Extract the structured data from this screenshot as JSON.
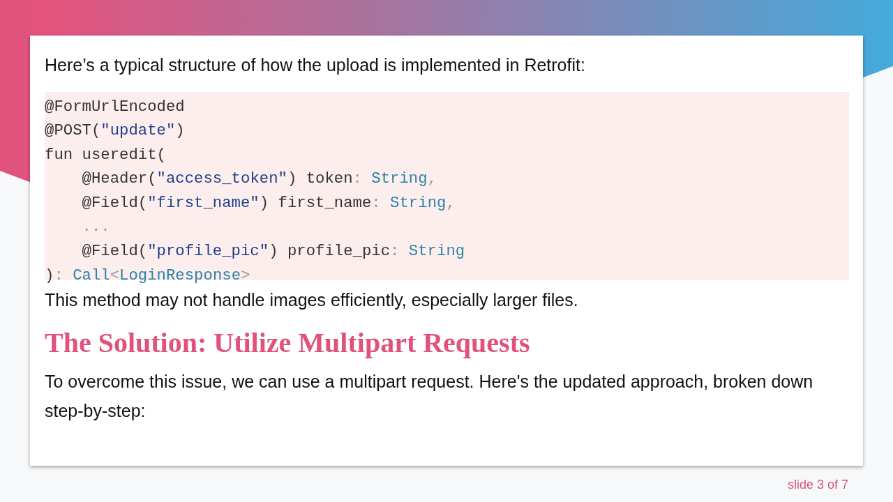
{
  "intro": "Here’s a typical structure of how the upload is implemented in Retrofit:",
  "code": {
    "lines": [
      {
        "segments": [
          {
            "kind": "plain",
            "text": "@FormUrlEncoded"
          }
        ]
      },
      {
        "segments": [
          {
            "kind": "plain",
            "text": "@POST("
          },
          {
            "kind": "string",
            "text": "\"update\""
          },
          {
            "kind": "plain",
            "text": ")"
          }
        ]
      },
      {
        "segments": [
          {
            "kind": "plain",
            "text": "fun useredit("
          }
        ]
      },
      {
        "segments": [
          {
            "kind": "plain",
            "text": "    @Header("
          },
          {
            "kind": "string",
            "text": "\"access_token\""
          },
          {
            "kind": "plain",
            "text": ") token"
          },
          {
            "kind": "punct",
            "text": ": "
          },
          {
            "kind": "type",
            "text": "String"
          },
          {
            "kind": "punct",
            "text": ","
          }
        ]
      },
      {
        "segments": [
          {
            "kind": "plain",
            "text": "    @Field("
          },
          {
            "kind": "string",
            "text": "\"first_name\""
          },
          {
            "kind": "plain",
            "text": ") first_name"
          },
          {
            "kind": "punct",
            "text": ": "
          },
          {
            "kind": "type",
            "text": "String"
          },
          {
            "kind": "punct",
            "text": ","
          }
        ]
      },
      {
        "segments": [
          {
            "kind": "punct",
            "text": "    ..."
          }
        ]
      },
      {
        "segments": [
          {
            "kind": "plain",
            "text": "    @Field("
          },
          {
            "kind": "string",
            "text": "\"profile_pic\""
          },
          {
            "kind": "plain",
            "text": ") profile_pic"
          },
          {
            "kind": "punct",
            "text": ": "
          },
          {
            "kind": "type",
            "text": "String"
          }
        ]
      },
      {
        "segments": [
          {
            "kind": "plain",
            "text": ")"
          },
          {
            "kind": "punct",
            "text": ": "
          },
          {
            "kind": "type",
            "text": "Call"
          },
          {
            "kind": "punct",
            "text": "<"
          },
          {
            "kind": "type",
            "text": "LoginResponse"
          },
          {
            "kind": "punct",
            "text": ">"
          }
        ]
      }
    ]
  },
  "note": "This method may not handle images efficiently, especially larger files.",
  "heading": "The Solution: Utilize Multipart Requests",
  "paragraph": "To overcome this issue, we can use a multipart request. Here's the updated approach, broken down step-by-step:",
  "footer": "slide 3 of 7"
}
